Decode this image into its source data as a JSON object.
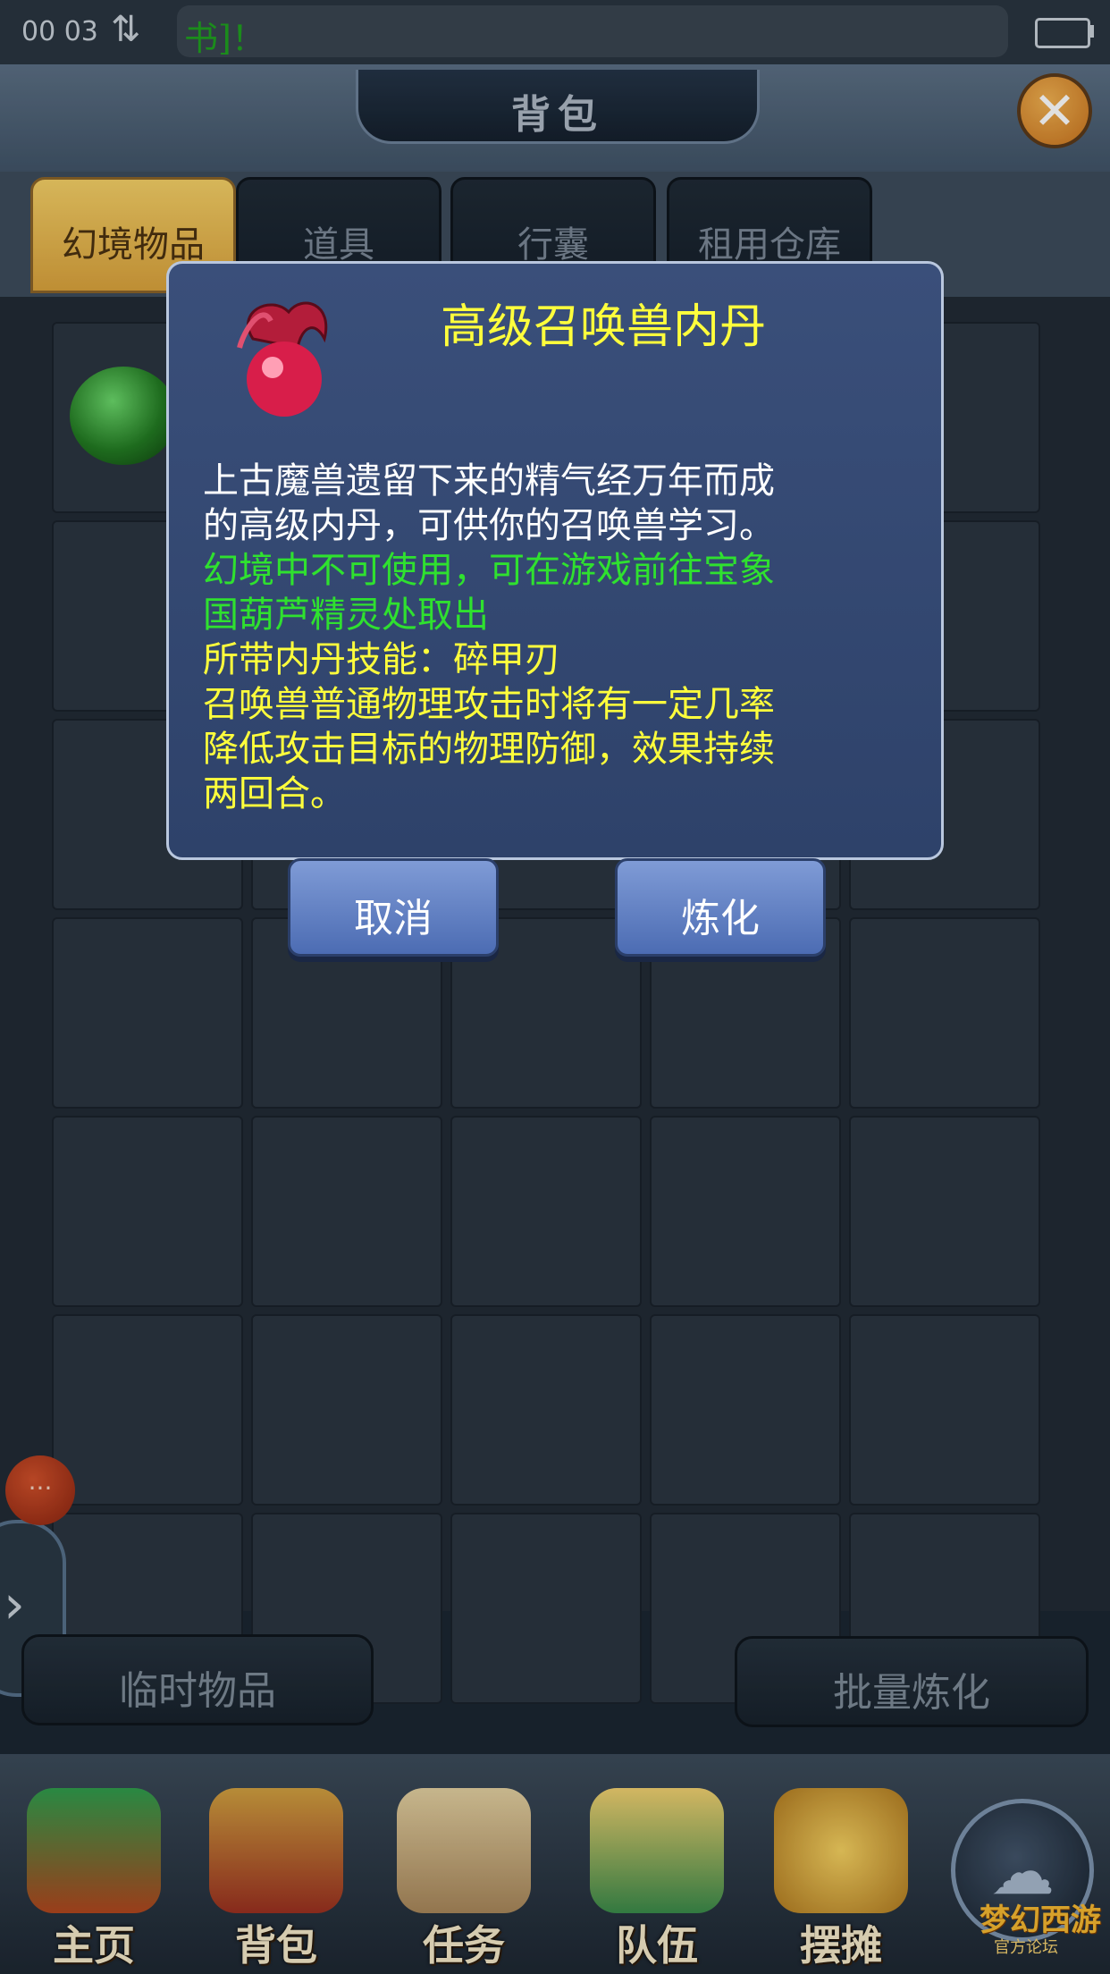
{
  "status": {
    "time": "00 03",
    "marquee": "书]！"
  },
  "header": {
    "title": "背包"
  },
  "tabs": [
    {
      "label": "幻境物品",
      "active": true
    },
    {
      "label": "道具",
      "active": false
    },
    {
      "label": "行囊",
      "active": false
    },
    {
      "label": "租用仓库",
      "active": false
    }
  ],
  "side": {
    "notification": "..."
  },
  "bottom": {
    "temp_items": "临时物品",
    "batch_refine": "批量炼化"
  },
  "nav": [
    {
      "label": "主页",
      "icon": "home-building-icon"
    },
    {
      "label": "背包",
      "icon": "treasure-chest-icon"
    },
    {
      "label": "任务",
      "icon": "scroll-icon"
    },
    {
      "label": "队伍",
      "icon": "team-icon"
    },
    {
      "label": "摆摊",
      "icon": "coin-stall-icon"
    }
  ],
  "watermark": {
    "title": "梦幻西游",
    "subtitle": "官方论坛"
  },
  "dialog": {
    "title": "高级召唤兽内丹",
    "lines": [
      {
        "text": "上古魔兽遗留下来的精气经万年而成",
        "color": "white"
      },
      {
        "text": "的高级内丹，可供你的召唤兽学习。",
        "color": "white"
      },
      {
        "text": "幻境中不可使用，可在游戏前往宝象",
        "color": "green"
      },
      {
        "text": "国葫芦精灵处取出",
        "color": "green"
      },
      {
        "text": "所带内丹技能：碎甲刃",
        "color": "yellow"
      },
      {
        "text": "召唤兽普通物理攻击时将有一定几率",
        "color": "yellow"
      },
      {
        "text": "降低攻击目标的物理防御，效果持续",
        "color": "yellow"
      },
      {
        "text": "两回合。",
        "color": "yellow"
      }
    ],
    "cancel": "取消",
    "refine": "炼化"
  },
  "colors": {
    "title_yellow": "#ffff3c",
    "green_text": "#2fe12f",
    "active_tab": "#f4cf66"
  }
}
